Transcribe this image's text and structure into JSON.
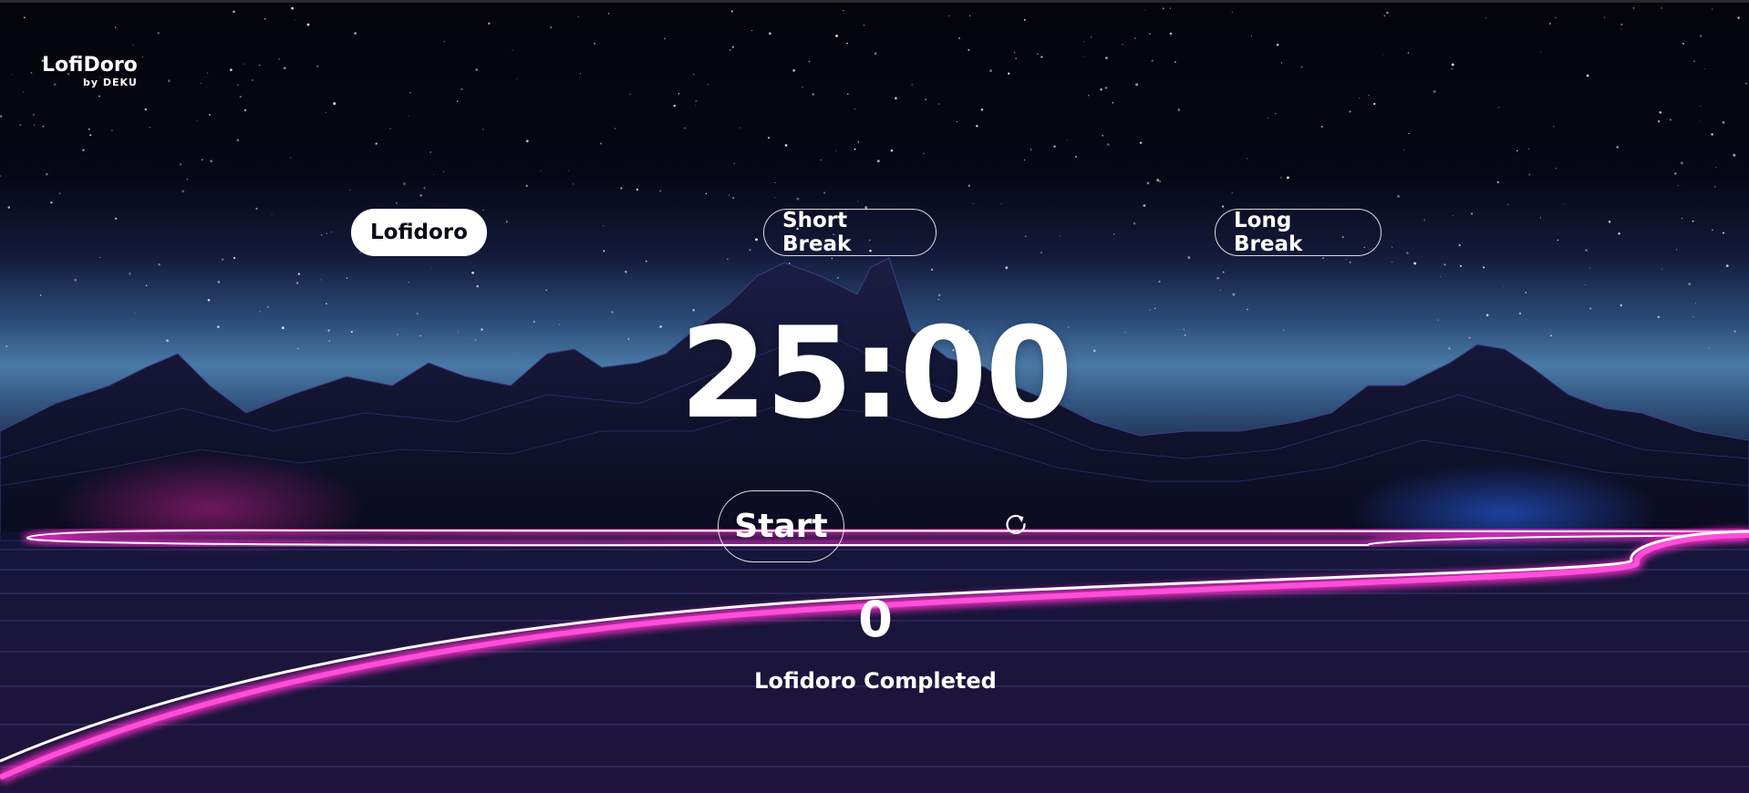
{
  "brand": {
    "title": "LofiDoro",
    "subtitle": "by DEKU"
  },
  "modes": [
    {
      "label": "Lofidoro",
      "active": true
    },
    {
      "label": "Short Break",
      "active": false
    },
    {
      "label": "Long Break",
      "active": false
    }
  ],
  "timer": {
    "display": "25:00"
  },
  "controls": {
    "start_label": "Start",
    "reset_icon": "reset-icon"
  },
  "progress": {
    "completed_count": "0",
    "completed_label": "Lofidoro Completed"
  },
  "colors": {
    "accent_neon_pink": "#ff2fd0",
    "active_button_bg": "#ffffff",
    "text": "#ffffff"
  }
}
